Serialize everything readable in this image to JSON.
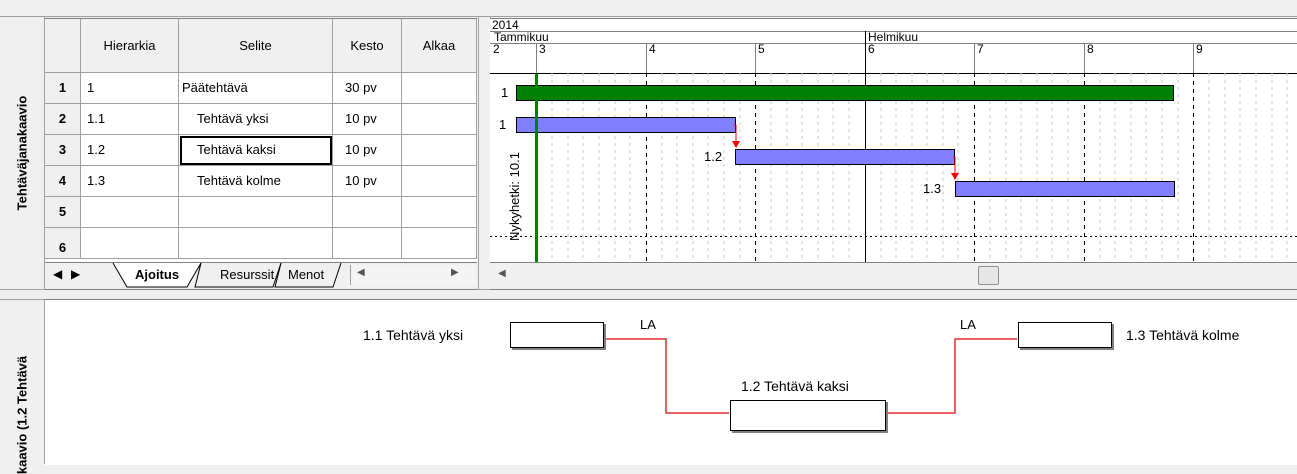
{
  "top_strip_label": "Tehtäväjanakaavio",
  "bottom_strip_label": "kaavio (1.2 Tehtävä",
  "grid": {
    "columns": [
      "Hierarkia",
      "Selite",
      "Kesto",
      "Alkaa"
    ],
    "rows": [
      {
        "num": "1",
        "hierarchy": "1",
        "title": "Päätehtävä",
        "duration": "30 pv",
        "start": ""
      },
      {
        "num": "2",
        "hierarchy": "1.1",
        "title": "Tehtävä yksi",
        "duration": "10 pv",
        "start": ""
      },
      {
        "num": "3",
        "hierarchy": "1.2",
        "title": "Tehtävä kaksi",
        "duration": "10 pv",
        "start": ""
      },
      {
        "num": "4",
        "hierarchy": "1.3",
        "title": "Tehtävä kolme",
        "duration": "10 pv",
        "start": ""
      },
      {
        "num": "5",
        "hierarchy": "",
        "title": "",
        "duration": "",
        "start": ""
      },
      {
        "num": "6",
        "hierarchy": "",
        "title": "",
        "duration": "",
        "start": ""
      }
    ]
  },
  "tabs": [
    {
      "label": "Ajoitus",
      "active": true
    },
    {
      "label": "Resurssit",
      "active": false
    },
    {
      "label": "Menot",
      "active": false
    }
  ],
  "gantt": {
    "year": "2014",
    "months": [
      "Tammikuu",
      "Helmikuu"
    ],
    "weeks": [
      "2",
      "3",
      "4",
      "5",
      "6",
      "7",
      "8",
      "9"
    ],
    "row_labels": [
      "1",
      "1",
      "1.2",
      "1.3"
    ],
    "today_label": "Nykyhetki: 10.1",
    "colors": {
      "summary": "#008000",
      "task": "#8080ff",
      "today": "#008000",
      "link": "#ff0000"
    }
  },
  "diagram": {
    "nodes": [
      {
        "label": "1.1 Tehtävä yksi"
      },
      {
        "label": "1.2 Tehtävä kaksi"
      },
      {
        "label": "1.3 Tehtävä kolme"
      }
    ],
    "link_labels": [
      "LA",
      "LA"
    ]
  }
}
